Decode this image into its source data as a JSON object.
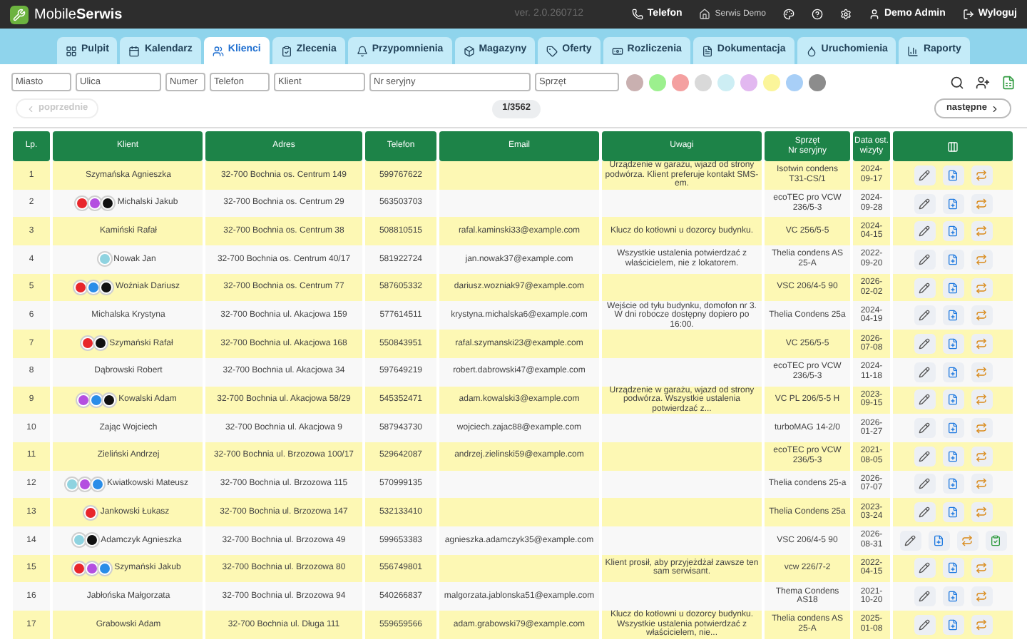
{
  "topbar": {
    "logo": "Mobile**Serwis**",
    "version": "ver. 2.0.260712",
    "phone": "Telefon",
    "company": "Serwis Demo",
    "user": "Demo Admin",
    "logout": "Wyloguj"
  },
  "tabs": [
    {
      "label": "Pulpit",
      "selected": false
    },
    {
      "label": "Kalendarz",
      "selected": false
    },
    {
      "label": "Klienci",
      "selected": true
    },
    {
      "label": "Zlecenia",
      "selected": false
    },
    {
      "label": "Przypomnienia",
      "selected": false
    },
    {
      "label": "Magazyny",
      "selected": false
    },
    {
      "label": "Oferty",
      "selected": false
    },
    {
      "label": "Rozliczenia",
      "selected": false
    },
    {
      "label": "Dokumentacja",
      "selected": false
    },
    {
      "label": "Uruchomienia",
      "selected": false
    },
    {
      "label": "Raporty",
      "selected": false
    }
  ],
  "filters": {
    "fields": [
      {
        "placeholder": "Miasto"
      },
      {
        "placeholder": "Ulica"
      },
      {
        "placeholder": "Numer"
      },
      {
        "placeholder": "Telefon"
      },
      {
        "placeholder": "Klient"
      },
      {
        "placeholder": "Nr seryjny"
      },
      {
        "placeholder": "Sprzęt"
      }
    ],
    "swatches": [
      {
        "color": "#c9b0b0"
      },
      {
        "color": "#9cf08e"
      },
      {
        "color": "#f4a0a0"
      },
      {
        "color": "#d9d9d9"
      },
      {
        "color": "#cdeef4"
      },
      {
        "color": "#e2b8f0"
      },
      {
        "color": "#fbf59a"
      },
      {
        "color": "#a8cff7"
      },
      {
        "color": "#8c8c8c"
      }
    ]
  },
  "pagination": {
    "previous": "poprzednie",
    "previous_disabled": true,
    "page": "1/3562",
    "next": "następne"
  },
  "table": {
    "columns": [
      "Lp.",
      "Klient",
      "Adres",
      "Telefon",
      "Email",
      "Uwagi",
      "Sprzęt\nNr seryjny",
      "Data ost. wizyty"
    ],
    "rows": [
      {
        "lp": "1",
        "client": "Szymańska Agnieszka",
        "tags": [],
        "address": "32-700 Bochnia os. Centrum 149",
        "phone": "599767622",
        "email": "",
        "notes": "Urządzenie w garażu, wjazd od strony podwórza. Klient preferuje kontakt SMS-em.",
        "device": "Isotwin condens T31-CS/1",
        "date": "2024-09-17",
        "actions": [
          {
            "kind": "edit"
          },
          {
            "kind": "document"
          },
          {
            "kind": "recurring"
          }
        ]
      },
      {
        "lp": "2",
        "client": "Michalski Jakub",
        "tags": [
          {
            "color": "#e8262b"
          },
          {
            "color": "#b44fe0"
          },
          {
            "color": "#111111"
          }
        ],
        "address": "32-700 Bochnia os. Centrum 29",
        "phone": "563503703",
        "email": "",
        "notes": "",
        "device": "ecoTEC pro VCW 236/5-3",
        "date": "2024-09-28",
        "actions": [
          {
            "kind": "edit"
          },
          {
            "kind": "document"
          },
          {
            "kind": "recurring"
          }
        ]
      },
      {
        "lp": "3",
        "client": "Kamiński Rafał",
        "tags": [],
        "address": "32-700 Bochnia os. Centrum 38",
        "phone": "508810515",
        "email": "rafal.kaminski33@example.com",
        "notes": "Klucz do kotłowni u dozorcy budynku.",
        "device": "VC 256/5-5",
        "date": "2024-04-15",
        "actions": [
          {
            "kind": "edit"
          },
          {
            "kind": "document"
          },
          {
            "kind": "recurring"
          }
        ]
      },
      {
        "lp": "4",
        "client": "Nowak Jan",
        "tags": [
          {
            "color": "#8fd3e0"
          }
        ],
        "address": "32-700 Bochnia os. Centrum 40/17",
        "phone": "581922724",
        "email": "jan.nowak37@example.com",
        "notes": "Wszystkie ustalenia potwierdzać z właścicielem, nie z lokatorem.",
        "device": "Thelia condens AS 25-A",
        "date": "2022-09-20",
        "actions": [
          {
            "kind": "edit"
          },
          {
            "kind": "document"
          },
          {
            "kind": "recurring"
          }
        ]
      },
      {
        "lp": "5",
        "client": "Woźniak Dariusz",
        "tags": [
          {
            "color": "#e8262b"
          },
          {
            "color": "#2a8de8"
          },
          {
            "color": "#111111"
          }
        ],
        "address": "32-700 Bochnia os. Centrum 77",
        "phone": "587605332",
        "email": "dariusz.wozniak97@example.com",
        "notes": "",
        "device": "VSC 206/4-5 90",
        "date": "2026-02-02",
        "actions": [
          {
            "kind": "edit"
          },
          {
            "kind": "document"
          },
          {
            "kind": "recurring"
          }
        ]
      },
      {
        "lp": "6",
        "client": "Michalska Krystyna",
        "tags": [],
        "address": "32-700 Bochnia ul. Akacjowa 159",
        "phone": "577614511",
        "email": "krystyna.michalska6@example.com",
        "notes": "Wejście od tyłu budynku, domofon nr 3. W dni robocze dostępny dopiero po 16:00.",
        "device": "Thelia Condens 25a",
        "date": "2024-04-19",
        "actions": [
          {
            "kind": "edit"
          },
          {
            "kind": "document"
          },
          {
            "kind": "recurring"
          }
        ]
      },
      {
        "lp": "7",
        "client": "Szymański Rafał",
        "tags": [
          {
            "color": "#e8262b"
          },
          {
            "color": "#111111"
          }
        ],
        "address": "32-700 Bochnia ul. Akacjowa 168",
        "phone": "550843951",
        "email": "rafal.szymanski23@example.com",
        "notes": "",
        "device": "VC 256/5-5",
        "date": "2026-07-08",
        "actions": [
          {
            "kind": "edit"
          },
          {
            "kind": "document"
          },
          {
            "kind": "recurring"
          }
        ]
      },
      {
        "lp": "8",
        "client": "Dąbrowski Robert",
        "tags": [],
        "address": "32-700 Bochnia ul. Akacjowa 34",
        "phone": "597649219",
        "email": "robert.dabrowski47@example.com",
        "notes": "",
        "device": "ecoTEC pro VCW 236/5-3",
        "date": "2024-11-18",
        "actions": [
          {
            "kind": "edit"
          },
          {
            "kind": "document"
          },
          {
            "kind": "recurring"
          }
        ]
      },
      {
        "lp": "9",
        "client": "Kowalski Adam",
        "tags": [
          {
            "color": "#b44fe0"
          },
          {
            "color": "#2a8de8"
          },
          {
            "color": "#111111"
          }
        ],
        "address": "32-700 Bochnia ul. Akacjowa 58/29",
        "phone": "545352471",
        "email": "adam.kowalski3@example.com",
        "notes": "Urządzenie w garażu, wjazd od strony podwórza. Wszystkie ustalenia potwierdzać z...",
        "device": "VC PL 206/5-5 H",
        "date": "2023-09-15",
        "actions": [
          {
            "kind": "edit"
          },
          {
            "kind": "document"
          },
          {
            "kind": "recurring"
          }
        ]
      },
      {
        "lp": "10",
        "client": "Zając Wojciech",
        "tags": [],
        "address": "32-700 Bochnia ul. Akacjowa 9",
        "phone": "587943730",
        "email": "wojciech.zajac88@example.com",
        "notes": "",
        "device": "turboMAG 14-2/0",
        "date": "2026-01-27",
        "actions": [
          {
            "kind": "edit"
          },
          {
            "kind": "document"
          },
          {
            "kind": "recurring"
          }
        ]
      },
      {
        "lp": "11",
        "client": "Zieliński Andrzej",
        "tags": [],
        "address": "32-700 Bochnia ul. Brzozowa 100/17",
        "phone": "529642087",
        "email": "andrzej.zielinski59@example.com",
        "notes": "",
        "device": "ecoTEC pro VCW 236/5-3",
        "date": "2021-08-05",
        "actions": [
          {
            "kind": "edit"
          },
          {
            "kind": "document"
          },
          {
            "kind": "recurring"
          }
        ]
      },
      {
        "lp": "12",
        "client": "Kwiatkowski Mateusz",
        "tags": [
          {
            "color": "#8fd3e0"
          },
          {
            "color": "#b44fe0"
          },
          {
            "color": "#2a8de8"
          }
        ],
        "address": "32-700 Bochnia ul. Brzozowa 115",
        "phone": "570999135",
        "email": "",
        "notes": "",
        "device": "Thelia condens 25-a",
        "date": "2026-07-07",
        "actions": [
          {
            "kind": "edit"
          },
          {
            "kind": "document"
          },
          {
            "kind": "recurring"
          }
        ]
      },
      {
        "lp": "13",
        "client": "Jankowski Łukasz",
        "tags": [
          {
            "color": "#e8262b"
          }
        ],
        "address": "32-700 Bochnia ul. Brzozowa 147",
        "phone": "532133410",
        "email": "",
        "notes": "",
        "device": "Thelia Condens 25a",
        "date": "2023-03-24",
        "actions": [
          {
            "kind": "edit"
          },
          {
            "kind": "document"
          },
          {
            "kind": "recurring"
          }
        ]
      },
      {
        "lp": "14",
        "client": "Adamczyk Agnieszka",
        "tags": [
          {
            "color": "#8fd3e0"
          },
          {
            "color": "#111111"
          }
        ],
        "address": "32-700 Bochnia ul. Brzozowa 49",
        "phone": "599653383",
        "email": "agnieszka.adamczyk35@example.com",
        "notes": "",
        "device": "VSC 206/4-5 90",
        "date": "2026-08-31",
        "actions": [
          {
            "kind": "edit"
          },
          {
            "kind": "document"
          },
          {
            "kind": "recurring"
          },
          {
            "kind": "report"
          }
        ]
      },
      {
        "lp": "15",
        "client": "Szymański Jakub",
        "tags": [
          {
            "color": "#e8262b"
          },
          {
            "color": "#b44fe0"
          },
          {
            "color": "#2a8de8"
          }
        ],
        "address": "32-700 Bochnia ul. Brzozowa 80",
        "phone": "556749801",
        "email": "",
        "notes": "Klient prosił, aby przyjeżdżał zawsze ten sam serwisant.",
        "device": "vcw 226/7-2",
        "date": "2022-04-15",
        "actions": [
          {
            "kind": "edit"
          },
          {
            "kind": "document"
          },
          {
            "kind": "recurring"
          }
        ]
      },
      {
        "lp": "16",
        "client": "Jabłońska Małgorzata",
        "tags": [],
        "address": "32-700 Bochnia ul. Brzozowa 94",
        "phone": "540266837",
        "email": "malgorzata.jablonska51@example.com",
        "notes": "",
        "device": "Thema Condens AS18",
        "date": "2021-10-20",
        "actions": [
          {
            "kind": "edit"
          },
          {
            "kind": "document"
          },
          {
            "kind": "recurring"
          }
        ]
      },
      {
        "lp": "17",
        "client": "Grabowski Adam",
        "tags": [],
        "address": "32-700 Bochnia ul. Długa 111",
        "phone": "559659566",
        "email": "adam.grabowski79@example.com",
        "notes": "Klucz do kotłowni u dozorcy budynku. Wszystkie ustalenia potwierdzać z właścicielem, nie...",
        "device": "Thelia condens AS 25-A",
        "date": "2025-01-08",
        "actions": [
          {
            "kind": "edit"
          },
          {
            "kind": "document"
          },
          {
            "kind": "recurring"
          }
        ]
      }
    ]
  }
}
